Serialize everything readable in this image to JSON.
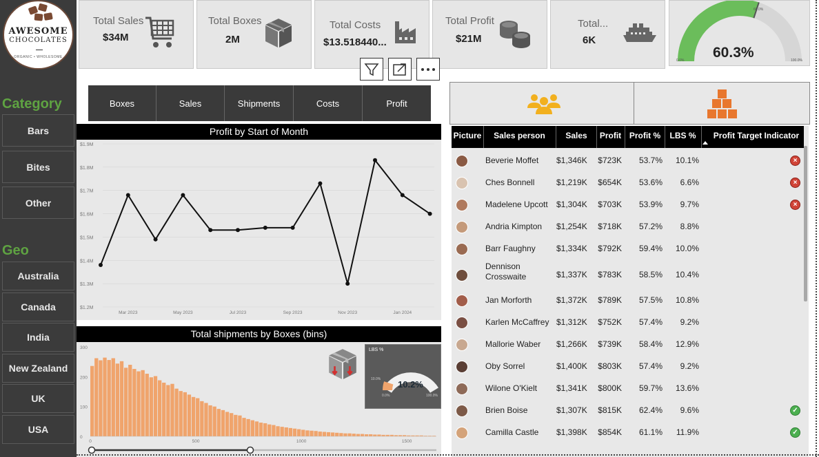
{
  "brand": {
    "line1": "AWESOME",
    "line2": "CHOCOLATES",
    "tagline": "ORGANIC • WHOLESOME"
  },
  "sidebar": {
    "category_title": "Category",
    "categories": [
      "Bars",
      "Bites",
      "Other"
    ],
    "geo_title": "Geo",
    "geos": [
      "Australia",
      "Canada",
      "India",
      "New Zealand",
      "UK",
      "USA"
    ]
  },
  "kpis": [
    {
      "label": "Total Sales",
      "value": "$34M",
      "icon": "shopping-cart-icon"
    },
    {
      "label": "Total Boxes",
      "value": "2M",
      "icon": "box-icon"
    },
    {
      "label": "Total Costs",
      "value": "$13.518440...",
      "icon": "factory-icon"
    },
    {
      "label": "Total Profit",
      "value": "$21M",
      "icon": "coins-icon"
    },
    {
      "label": "Total...",
      "value": "6K",
      "icon": "ship-icon"
    }
  ],
  "gauge_top": {
    "value": "60.3%",
    "target_label": "60.0%",
    "min_label": "0.0%",
    "max_label": "100.0%",
    "fraction": 0.603
  },
  "toolbar": {
    "filter_icon": "filter-icon",
    "focus_icon": "focus-mode-icon",
    "more_icon": "more-options-icon"
  },
  "tabs": [
    "Boxes",
    "Sales",
    "Shipments",
    "Costs",
    "Profit"
  ],
  "line_chart": {
    "title": "Profit by Start of Month"
  },
  "histogram": {
    "title": "Total shipments by Boxes (bins)"
  },
  "mini_gauge": {
    "label": "LBS %",
    "value": "10.2%",
    "left_label": "10.0%",
    "min_label": "0.0%",
    "max_label": "100.0%",
    "fraction": 0.102
  },
  "table": {
    "headers": [
      "Picture",
      "Sales person",
      "Sales",
      "Profit",
      "Profit %",
      "LBS %",
      "Profit Target Indicator"
    ],
    "rows": [
      {
        "name": "Beverie Moffet",
        "sales": "$1,346K",
        "profit": "$723K",
        "profit_pct": "53.7%",
        "lbs_pct": "10.1%",
        "indicator": "bad"
      },
      {
        "name": "Ches Bonnell",
        "sales": "$1,219K",
        "profit": "$654K",
        "profit_pct": "53.6%",
        "lbs_pct": "6.6%",
        "indicator": "bad"
      },
      {
        "name": "Madelene Upcott",
        "sales": "$1,304K",
        "profit": "$703K",
        "profit_pct": "53.9%",
        "lbs_pct": "9.7%",
        "indicator": "bad"
      },
      {
        "name": "Andria Kimpton",
        "sales": "$1,254K",
        "profit": "$718K",
        "profit_pct": "57.2%",
        "lbs_pct": "8.8%",
        "indicator": ""
      },
      {
        "name": "Barr Faughny",
        "sales": "$1,334K",
        "profit": "$792K",
        "profit_pct": "59.4%",
        "lbs_pct": "10.0%",
        "indicator": ""
      },
      {
        "name": "Dennison Crosswaite",
        "sales": "$1,337K",
        "profit": "$783K",
        "profit_pct": "58.5%",
        "lbs_pct": "10.4%",
        "indicator": ""
      },
      {
        "name": "Jan Morforth",
        "sales": "$1,372K",
        "profit": "$789K",
        "profit_pct": "57.5%",
        "lbs_pct": "10.8%",
        "indicator": ""
      },
      {
        "name": "Karlen McCaffrey",
        "sales": "$1,312K",
        "profit": "$752K",
        "profit_pct": "57.4%",
        "lbs_pct": "9.2%",
        "indicator": ""
      },
      {
        "name": "Mallorie Waber",
        "sales": "$1,266K",
        "profit": "$739K",
        "profit_pct": "58.4%",
        "lbs_pct": "12.9%",
        "indicator": ""
      },
      {
        "name": "Oby Sorrel",
        "sales": "$1,400K",
        "profit": "$803K",
        "profit_pct": "57.4%",
        "lbs_pct": "9.2%",
        "indicator": ""
      },
      {
        "name": "Wilone O'Kielt",
        "sales": "$1,341K",
        "profit": "$800K",
        "profit_pct": "59.7%",
        "lbs_pct": "13.6%",
        "indicator": ""
      },
      {
        "name": "Brien Boise",
        "sales": "$1,307K",
        "profit": "$815K",
        "profit_pct": "62.4%",
        "lbs_pct": "9.6%",
        "indicator": "good"
      },
      {
        "name": "Camilla Castle",
        "sales": "$1,398K",
        "profit": "$854K",
        "profit_pct": "61.1%",
        "lbs_pct": "11.9%",
        "indicator": "good"
      }
    ]
  },
  "colors": {
    "accent_green": "#5fa342",
    "bar_orange": "#f0a46c",
    "team_icon": "#f2b01e",
    "boxes_icon": "#e8772e"
  },
  "chart_data": [
    {
      "type": "line",
      "title": "Profit by Start of Month",
      "x": [
        "Feb 2023",
        "Mar 2023",
        "Apr 2023",
        "May 2023",
        "Jun 2023",
        "Jul 2023",
        "Aug 2023",
        "Sep 2023",
        "Oct 2023",
        "Nov 2023",
        "Dec 2023",
        "Jan 2024",
        "Feb 2024"
      ],
      "x_tick_labels": [
        "Mar 2023",
        "May 2023",
        "Jul 2023",
        "Sep 2023",
        "Nov 2023",
        "Jan 2024"
      ],
      "series": [
        {
          "values": [
            1.38,
            1.68,
            1.49,
            1.68,
            1.53,
            1.53,
            1.54,
            1.54,
            1.73,
            1.3,
            1.83,
            1.68,
            1.6
          ]
        }
      ],
      "y_tick_labels": [
        "$1.2M",
        "$1.3M",
        "$1.4M",
        "$1.5M",
        "$1.6M",
        "$1.7M",
        "$1.8M",
        "$1.9M"
      ],
      "ylim": [
        1.2,
        1.9
      ],
      "grid": true
    },
    {
      "type": "bar",
      "title": "Total shipments by Boxes (bins)",
      "x_tick_labels": [
        "0",
        "500",
        "1000",
        "1500"
      ],
      "y_tick_labels": [
        "0",
        "100",
        "200",
        "300"
      ],
      "xlim": [
        0,
        1640
      ],
      "ylim": [
        0,
        300
      ],
      "bin_width": 20,
      "values": [
        236,
        262,
        255,
        264,
        256,
        262,
        244,
        252,
        230,
        240,
        226,
        218,
        222,
        210,
        198,
        202,
        188,
        180,
        172,
        176,
        160,
        152,
        148,
        140,
        132,
        128,
        118,
        112,
        104,
        100,
        92,
        88,
        82,
        78,
        72,
        70,
        62,
        58,
        54,
        50,
        46,
        44,
        40,
        38,
        34,
        32,
        30,
        28,
        26,
        24,
        22,
        20,
        19,
        18,
        16,
        15,
        14,
        13,
        12,
        11,
        10,
        10,
        9,
        8,
        8,
        7,
        7,
        6,
        6,
        5,
        5,
        5,
        4,
        4,
        4,
        3,
        3,
        3,
        3,
        2,
        2,
        2
      ]
    }
  ]
}
